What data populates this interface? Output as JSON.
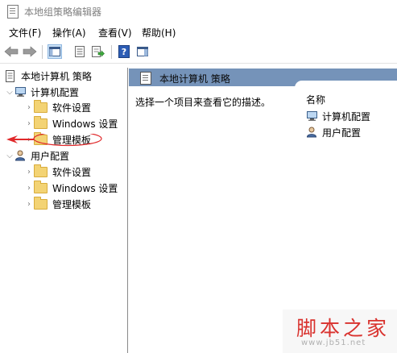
{
  "window": {
    "title": "本地组策略编辑器"
  },
  "menu": [
    "文件(F)",
    "操作(A)",
    "查看(V)",
    "帮助(H)"
  ],
  "toolbar": {
    "icons": [
      "back-arrow-icon",
      "forward-arrow-icon",
      "show-hide-tree-icon",
      "properties-icon",
      "export-list-icon",
      "help-icon",
      "show-hide-action-pane-icon"
    ]
  },
  "tree": {
    "root": "本地计算机 策略",
    "computer": {
      "label": "计算机配置",
      "children": [
        "软件设置",
        "Windows 设置",
        "管理模板"
      ]
    },
    "user": {
      "label": "用户配置",
      "children": [
        "软件设置",
        "Windows 设置",
        "管理模板"
      ]
    }
  },
  "right": {
    "header_title": "本地计算机 策略",
    "description": "选择一个项目来查看它的描述。",
    "column_name": "名称",
    "items": [
      "计算机配置",
      "用户配置"
    ]
  },
  "watermark": {
    "text": "脚本之家",
    "url": "www.jb51.net"
  },
  "colors": {
    "header_bg": "#7593b9",
    "annotation_red": "#e0282a",
    "folder": "#f3d374"
  }
}
